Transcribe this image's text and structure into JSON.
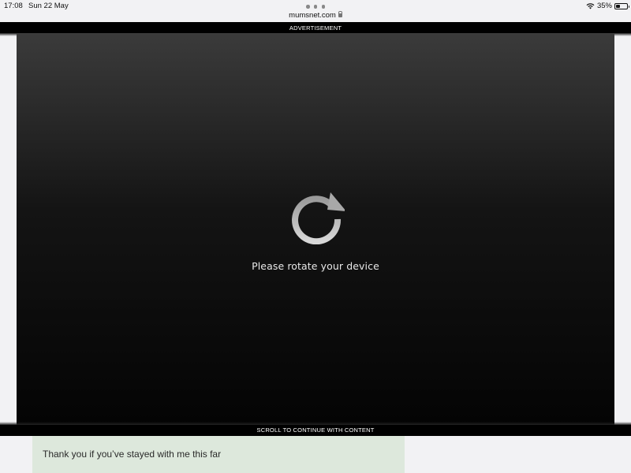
{
  "status_bar": {
    "time": "17:08",
    "date": "Sun 22 May",
    "battery_percent_label": "35%",
    "battery_level": 0.35
  },
  "browser": {
    "url": "mumsnet.com"
  },
  "advertisement": {
    "label": "ADVERTISEMENT",
    "message": "Please rotate your device",
    "scroll_hint": "SCROLL TO CONTINUE WITH CONTENT",
    "icon": "rotate-icon"
  },
  "post": {
    "text": "Thank you if you’ve stayed with me this far",
    "background_color": "#dde8dc"
  }
}
